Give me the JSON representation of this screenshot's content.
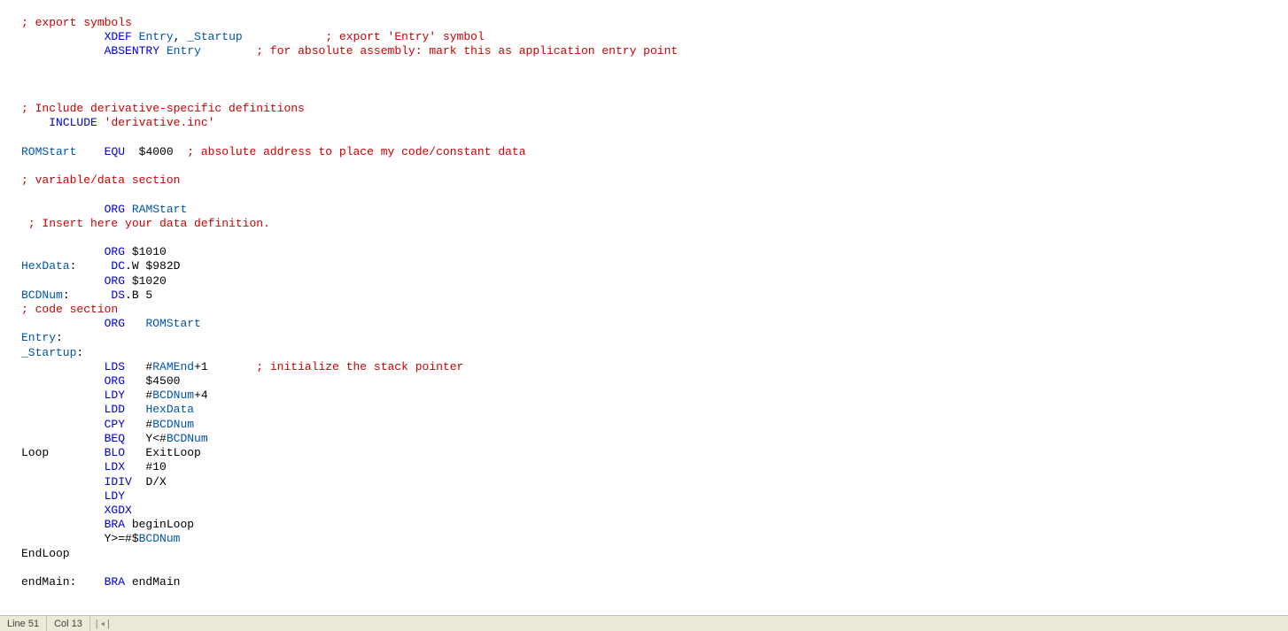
{
  "status": {
    "line": "Line 51",
    "col": "Col 13",
    "scroll": "|◂|"
  },
  "lines": [
    [
      [
        "c",
        "; export symbols"
      ]
    ],
    [
      [
        "d",
        "            "
      ],
      [
        "k",
        "XDEF"
      ],
      [
        "d",
        " "
      ],
      [
        "id",
        "Entry"
      ],
      [
        "d",
        ", "
      ],
      [
        "id",
        "_Startup"
      ],
      [
        "d",
        "            "
      ],
      [
        "c",
        "; export 'Entry' symbol"
      ]
    ],
    [
      [
        "d",
        "            "
      ],
      [
        "k",
        "ABSENTRY"
      ],
      [
        "d",
        " "
      ],
      [
        "id",
        "Entry"
      ],
      [
        "d",
        "        "
      ],
      [
        "c",
        "; for absolute assembly: mark this as application entry point"
      ]
    ],
    [],
    [],
    [],
    [
      [
        "c",
        "; Include derivative-specific definitions"
      ]
    ],
    [
      [
        "d",
        "    "
      ],
      [
        "k",
        "INCLUDE"
      ],
      [
        "d",
        " "
      ],
      [
        "c",
        "'derivative.inc'"
      ]
    ],
    [],
    [
      [
        "id",
        "ROMStart"
      ],
      [
        "d",
        "    "
      ],
      [
        "k",
        "EQU"
      ],
      [
        "d",
        "  $4000  "
      ],
      [
        "c",
        "; absolute address to place my code/constant data"
      ]
    ],
    [],
    [
      [
        "c",
        "; variable/data section"
      ]
    ],
    [],
    [
      [
        "d",
        "            "
      ],
      [
        "k",
        "ORG"
      ],
      [
        "d",
        " "
      ],
      [
        "id",
        "RAMStart"
      ]
    ],
    [
      [
        "d",
        " "
      ],
      [
        "c",
        "; Insert here your data definition."
      ]
    ],
    [],
    [
      [
        "d",
        "            "
      ],
      [
        "k",
        "ORG"
      ],
      [
        "d",
        " $1010"
      ]
    ],
    [
      [
        "id",
        "HexData"
      ],
      [
        "d",
        ":     "
      ],
      [
        "k",
        "DC"
      ],
      [
        "d",
        ".W $982D"
      ]
    ],
    [
      [
        "d",
        "            "
      ],
      [
        "k",
        "ORG"
      ],
      [
        "d",
        " $1020"
      ]
    ],
    [
      [
        "id",
        "BCDNum"
      ],
      [
        "d",
        ":      "
      ],
      [
        "k",
        "DS"
      ],
      [
        "d",
        ".B 5"
      ]
    ],
    [
      [
        "c",
        "; code section"
      ]
    ],
    [
      [
        "d",
        "            "
      ],
      [
        "k",
        "ORG"
      ],
      [
        "d",
        "   "
      ],
      [
        "id",
        "ROMStart"
      ]
    ],
    [
      [
        "id",
        "Entry"
      ],
      [
        "d",
        ":"
      ]
    ],
    [
      [
        "id",
        "_Startup"
      ],
      [
        "d",
        ":"
      ]
    ],
    [
      [
        "d",
        "            "
      ],
      [
        "k",
        "LDS"
      ],
      [
        "d",
        "   #"
      ],
      [
        "id",
        "RAMEnd"
      ],
      [
        "d",
        "+1       "
      ],
      [
        "c",
        "; initialize the stack pointer"
      ]
    ],
    [
      [
        "d",
        "            "
      ],
      [
        "k",
        "ORG"
      ],
      [
        "d",
        "   $4500"
      ]
    ],
    [
      [
        "d",
        "            "
      ],
      [
        "k",
        "LDY"
      ],
      [
        "d",
        "   #"
      ],
      [
        "id",
        "BCDNum"
      ],
      [
        "d",
        "+4"
      ]
    ],
    [
      [
        "d",
        "            "
      ],
      [
        "k",
        "LDD"
      ],
      [
        "d",
        "   "
      ],
      [
        "id",
        "HexData"
      ]
    ],
    [
      [
        "d",
        "            "
      ],
      [
        "k",
        "CPY"
      ],
      [
        "d",
        "   #"
      ],
      [
        "id",
        "BCDNum"
      ]
    ],
    [
      [
        "d",
        "            "
      ],
      [
        "k",
        "BEQ"
      ],
      [
        "d",
        "   Y<#"
      ],
      [
        "id",
        "BCDNum"
      ]
    ],
    [
      [
        "d",
        "Loop        "
      ],
      [
        "k",
        "BLO"
      ],
      [
        "d",
        "   ExitLoop"
      ]
    ],
    [
      [
        "d",
        "            "
      ],
      [
        "k",
        "LDX"
      ],
      [
        "d",
        "   #10"
      ]
    ],
    [
      [
        "d",
        "            "
      ],
      [
        "k",
        "IDIV"
      ],
      [
        "d",
        "  D/X"
      ]
    ],
    [
      [
        "d",
        "            "
      ],
      [
        "k",
        "LDY"
      ]
    ],
    [
      [
        "d",
        "            "
      ],
      [
        "k",
        "XGDX"
      ]
    ],
    [
      [
        "d",
        "            "
      ],
      [
        "k",
        "BRA"
      ],
      [
        "d",
        " beginLoop"
      ]
    ],
    [
      [
        "d",
        "            Y>=#$"
      ],
      [
        "id",
        "BCDNum"
      ]
    ],
    [
      [
        "d",
        "EndLoop"
      ]
    ],
    [],
    [
      [
        "d",
        "endMain:    "
      ],
      [
        "k",
        "BRA"
      ],
      [
        "d",
        " endMain"
      ]
    ]
  ]
}
